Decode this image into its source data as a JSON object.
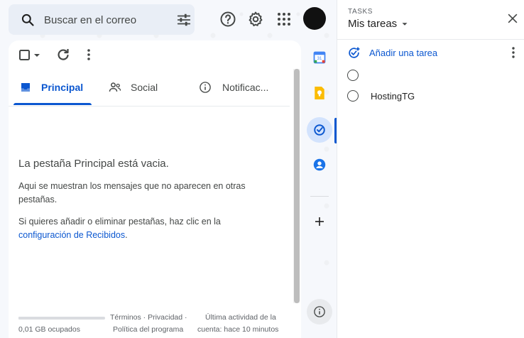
{
  "search": {
    "placeholder": "Buscar en el correo"
  },
  "header": {
    "help_icon": "help-circle-icon",
    "settings_icon": "gear-icon",
    "apps_icon": "apps-grid-icon",
    "account_icon": "avatar"
  },
  "toolbar": {
    "select_icon": "checkbox-icon",
    "refresh_icon": "refresh-icon",
    "more_icon": "kebab-icon"
  },
  "tabs": [
    {
      "label": "Principal",
      "icon": "inbox-icon",
      "active": true
    },
    {
      "label": "Social",
      "icon": "people-icon",
      "active": false
    },
    {
      "label": "Notificac...",
      "icon": "info-icon",
      "active": false
    }
  ],
  "empty": {
    "title": "La pestaña Principal está vacia.",
    "line1": "Aqui se muestran los mensajes que no aparecen en otras",
    "line2": "pestañas.",
    "line3": "Si quieres añadir o eliminar pestañas, haz clic en la",
    "link": "configuración de Recibidos",
    "link_suffix": "."
  },
  "footer": {
    "storage": "0,01 GB ocupados",
    "links": "Términos · Privacidad ·",
    "links2": "Política del programa",
    "activity": "Última actividad de la",
    "activity2": "cuenta: hace 10 minutos"
  },
  "rail": {
    "items": [
      "calendar-icon",
      "keep-icon",
      "tasks-icon",
      "contacts-icon"
    ],
    "add_icon": "plus-icon",
    "info_icon": "info-icon"
  },
  "tasks_panel": {
    "kicker": "TASKS",
    "list_name": "Mis tareas",
    "add_label": "Añadir una tarea",
    "items": [
      {
        "title": ""
      },
      {
        "title": "HostingTG"
      }
    ]
  },
  "colors": {
    "accent": "#0b57d0",
    "background": "#f6f8fc",
    "surface": "#ffffff"
  }
}
